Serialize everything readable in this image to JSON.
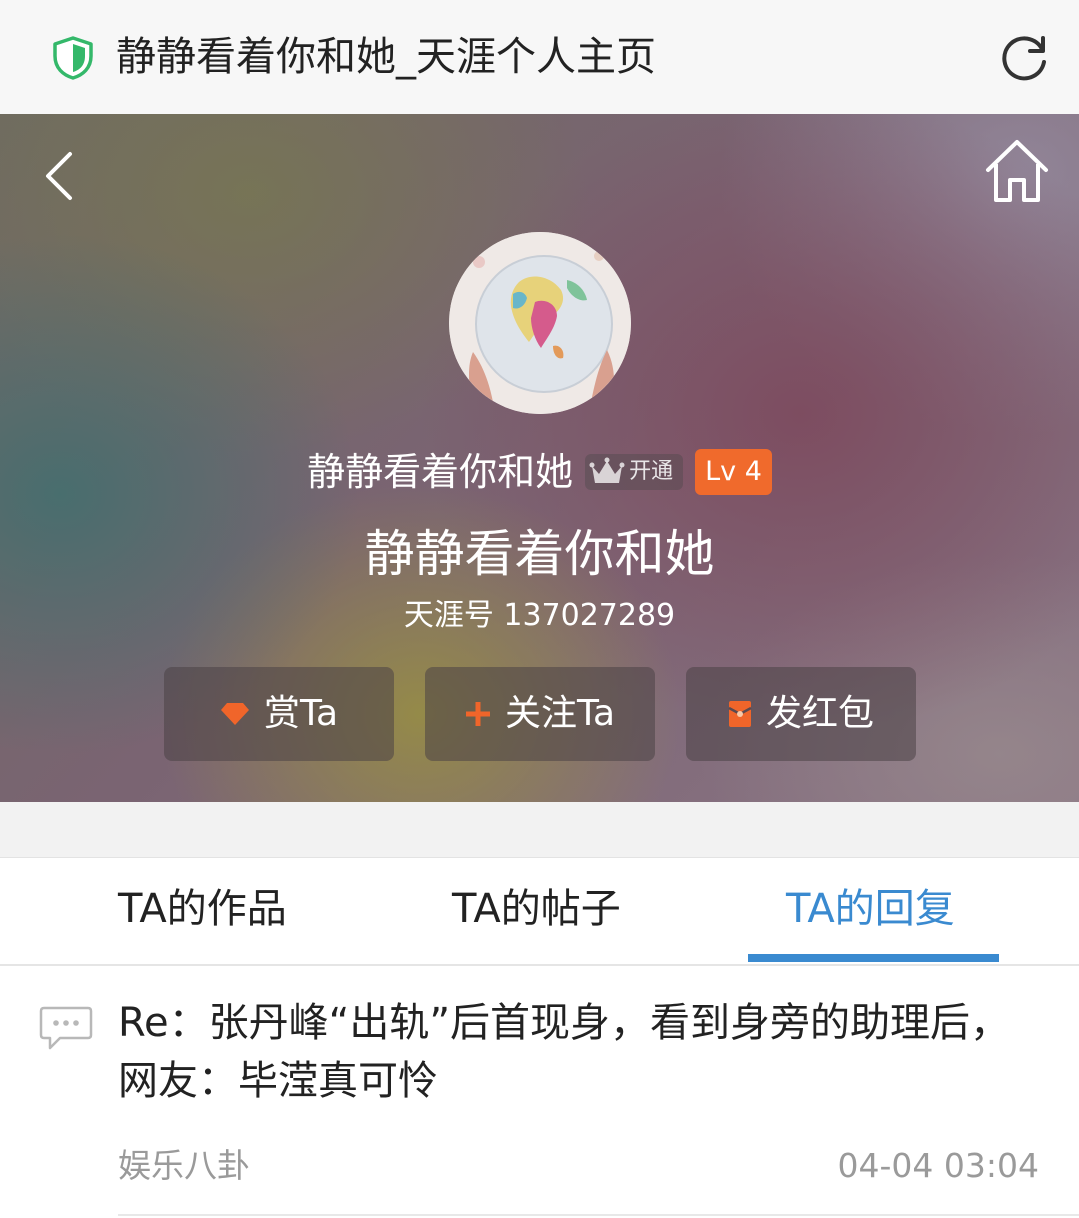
{
  "browser": {
    "page_title": "静静看着你和她_天涯个人主页",
    "icons": {
      "security": "shield-icon",
      "refresh": "refresh-icon"
    }
  },
  "profile": {
    "icons": {
      "back": "back-arrow-icon",
      "home": "home-icon",
      "vip": "crown-icon"
    },
    "display_name": "静静看着你和她",
    "vip_label": "开通",
    "level": "Lv 4",
    "nickname": "静静看着你和她",
    "tianya_id": "天涯号 137027289",
    "actions": {
      "reward": {
        "label": "赏Ta",
        "icon": "diamond-icon"
      },
      "follow": {
        "label": "关注Ta",
        "icon": "plus-icon"
      },
      "red_packet": {
        "label": "发红包",
        "icon": "red-packet-icon"
      }
    },
    "colors": {
      "level_badge": "#f06a2c",
      "action_icon": "#f0652a"
    }
  },
  "tabs": {
    "items": [
      {
        "label": "TA的作品",
        "active": false
      },
      {
        "label": "TA的帖子",
        "active": false
      },
      {
        "label": "TA的回复",
        "active": true
      }
    ],
    "active_color": "#3a8ad0"
  },
  "replies": [
    {
      "icon": "comment-icon",
      "title": "Re：张丹峰“出轨”后首现身，看到身旁的助理后，网友：毕滢真可怜",
      "category": "娱乐八卦",
      "time": "04-04 03:04"
    }
  ]
}
